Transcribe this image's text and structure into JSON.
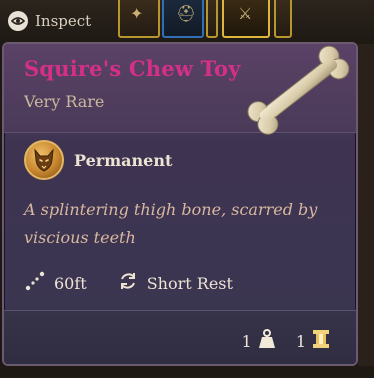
{
  "inspect": {
    "label": "Inspect",
    "icon": "eye-icon"
  },
  "item": {
    "name": "Squire's Chew Toy",
    "rarity": "Very Rare",
    "name_color": "#d52f88",
    "rarity_color": "#c9b99c",
    "icon": "bone-icon"
  },
  "trait": {
    "label": "Permanent",
    "icon": "wolf-badge-icon"
  },
  "description": "A splintering thigh bone, scarred by viscious teeth",
  "properties": {
    "range": "60ft",
    "range_icon": "range-icon",
    "recharge": "Short Rest",
    "recharge_icon": "recharge-icon"
  },
  "footer": {
    "weight": "1",
    "weight_icon": "weight-icon",
    "value": "1",
    "value_icon": "coin-icon"
  },
  "colors": {
    "tooltip_bg": "#3e3452",
    "description": "#d9b7a0",
    "text": "#ece3d2"
  }
}
